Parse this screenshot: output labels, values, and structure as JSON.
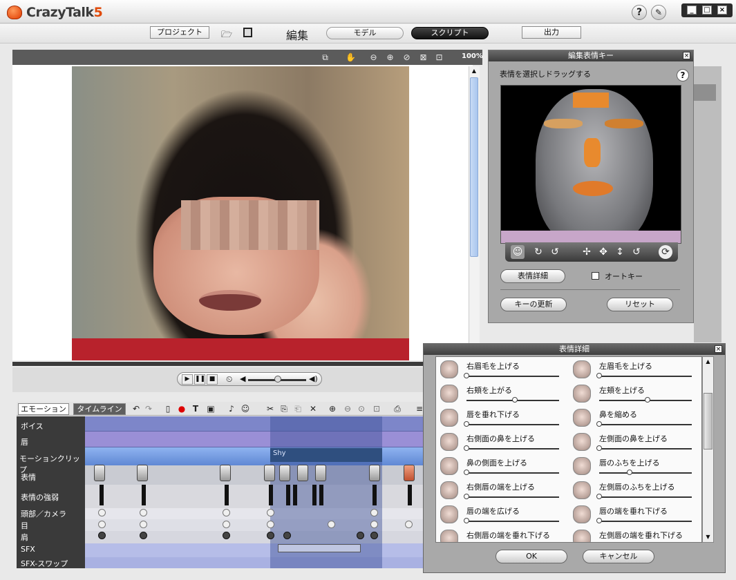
{
  "app": {
    "logo_text": "CrazyTalk",
    "logo_version": "5",
    "help_label": "?"
  },
  "window_controls": {
    "minimize": "_",
    "maximize": "□",
    "close": "×"
  },
  "nav": {
    "project": "プロジェクト",
    "edit_label": "編集",
    "model": "モデル",
    "script": "スクリプト",
    "output": "出力"
  },
  "viewer": {
    "zoom": "100%"
  },
  "timeline": {
    "tabs": [
      "エモーション",
      "タイムライン"
    ],
    "tracks": [
      "ボイス",
      "唇",
      "モーションクリップ",
      "表情",
      "表情の強弱",
      "頭部／カメラ",
      "目",
      "肩",
      "SFX",
      "SFX-スワップ"
    ],
    "clip_name": "Shy"
  },
  "expression_key_panel": {
    "title": "編集表情キー",
    "instruction": "表情を選択しドラッグする",
    "help": "?",
    "detail_button": "表情詳細",
    "autokey_label": "オートキー",
    "update_button": "キーの更新",
    "reset_button": "リセット"
  },
  "detail_dialog": {
    "title": "表情詳細",
    "ok": "OK",
    "cancel": "キャンセル",
    "items": [
      {
        "label": "右眉毛を上げる",
        "value": 0.0
      },
      {
        "label": "左眉毛を上げる",
        "value": 0.0
      },
      {
        "label": "右頬を上がる",
        "value": 0.52
      },
      {
        "label": "左頬を上げる",
        "value": 0.52
      },
      {
        "label": "唇を垂れ下げる",
        "value": 0.0
      },
      {
        "label": "鼻を縮める",
        "value": 0.0
      },
      {
        "label": "右側面の鼻を上げる",
        "value": 0.0
      },
      {
        "label": "左側面の鼻を上げる",
        "value": 0.0
      },
      {
        "label": "鼻の側面を上げる",
        "value": 0.0
      },
      {
        "label": "唇のふちを上げる",
        "value": 0.33
      },
      {
        "label": "右側唇の端を上げる",
        "value": 0.0
      },
      {
        "label": "左側唇のふちを上げる",
        "value": 0.0
      },
      {
        "label": "唇の端を広げる",
        "value": 0.0
      },
      {
        "label": "唇の端を垂れ下げる",
        "value": 0.0
      },
      {
        "label": "右側唇の端を垂れ下げる",
        "value": 0.0
      },
      {
        "label": "左側唇の端を垂れ下げる",
        "value": 0.0
      }
    ]
  }
}
